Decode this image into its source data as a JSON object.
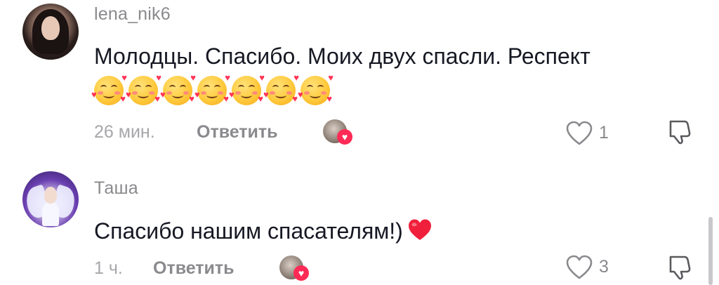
{
  "comments": [
    {
      "username": "lena_nik6",
      "text": "Молодцы. Спасибо. Моих двух спасли. Респект",
      "emoji_count": 7,
      "emoji_icon": "smiling-face-with-hearts-icon",
      "time": "26 мин.",
      "reply_label": "Ответить",
      "likes": "1"
    },
    {
      "username": "Таша",
      "text": "Спасибо нашим спасателям!)",
      "trailing_emoji": "red-heart-icon",
      "time": "1 ч.",
      "reply_label": "Ответить",
      "likes": "3"
    }
  ],
  "colors": {
    "username": "#8a8a8e",
    "text": "#161823",
    "time": "#a7a7ab",
    "heart_accent": "#ff2a55"
  },
  "icons": [
    "heart-outline-icon",
    "thumbs-down-outline-icon",
    "creator-liked-icon"
  ]
}
